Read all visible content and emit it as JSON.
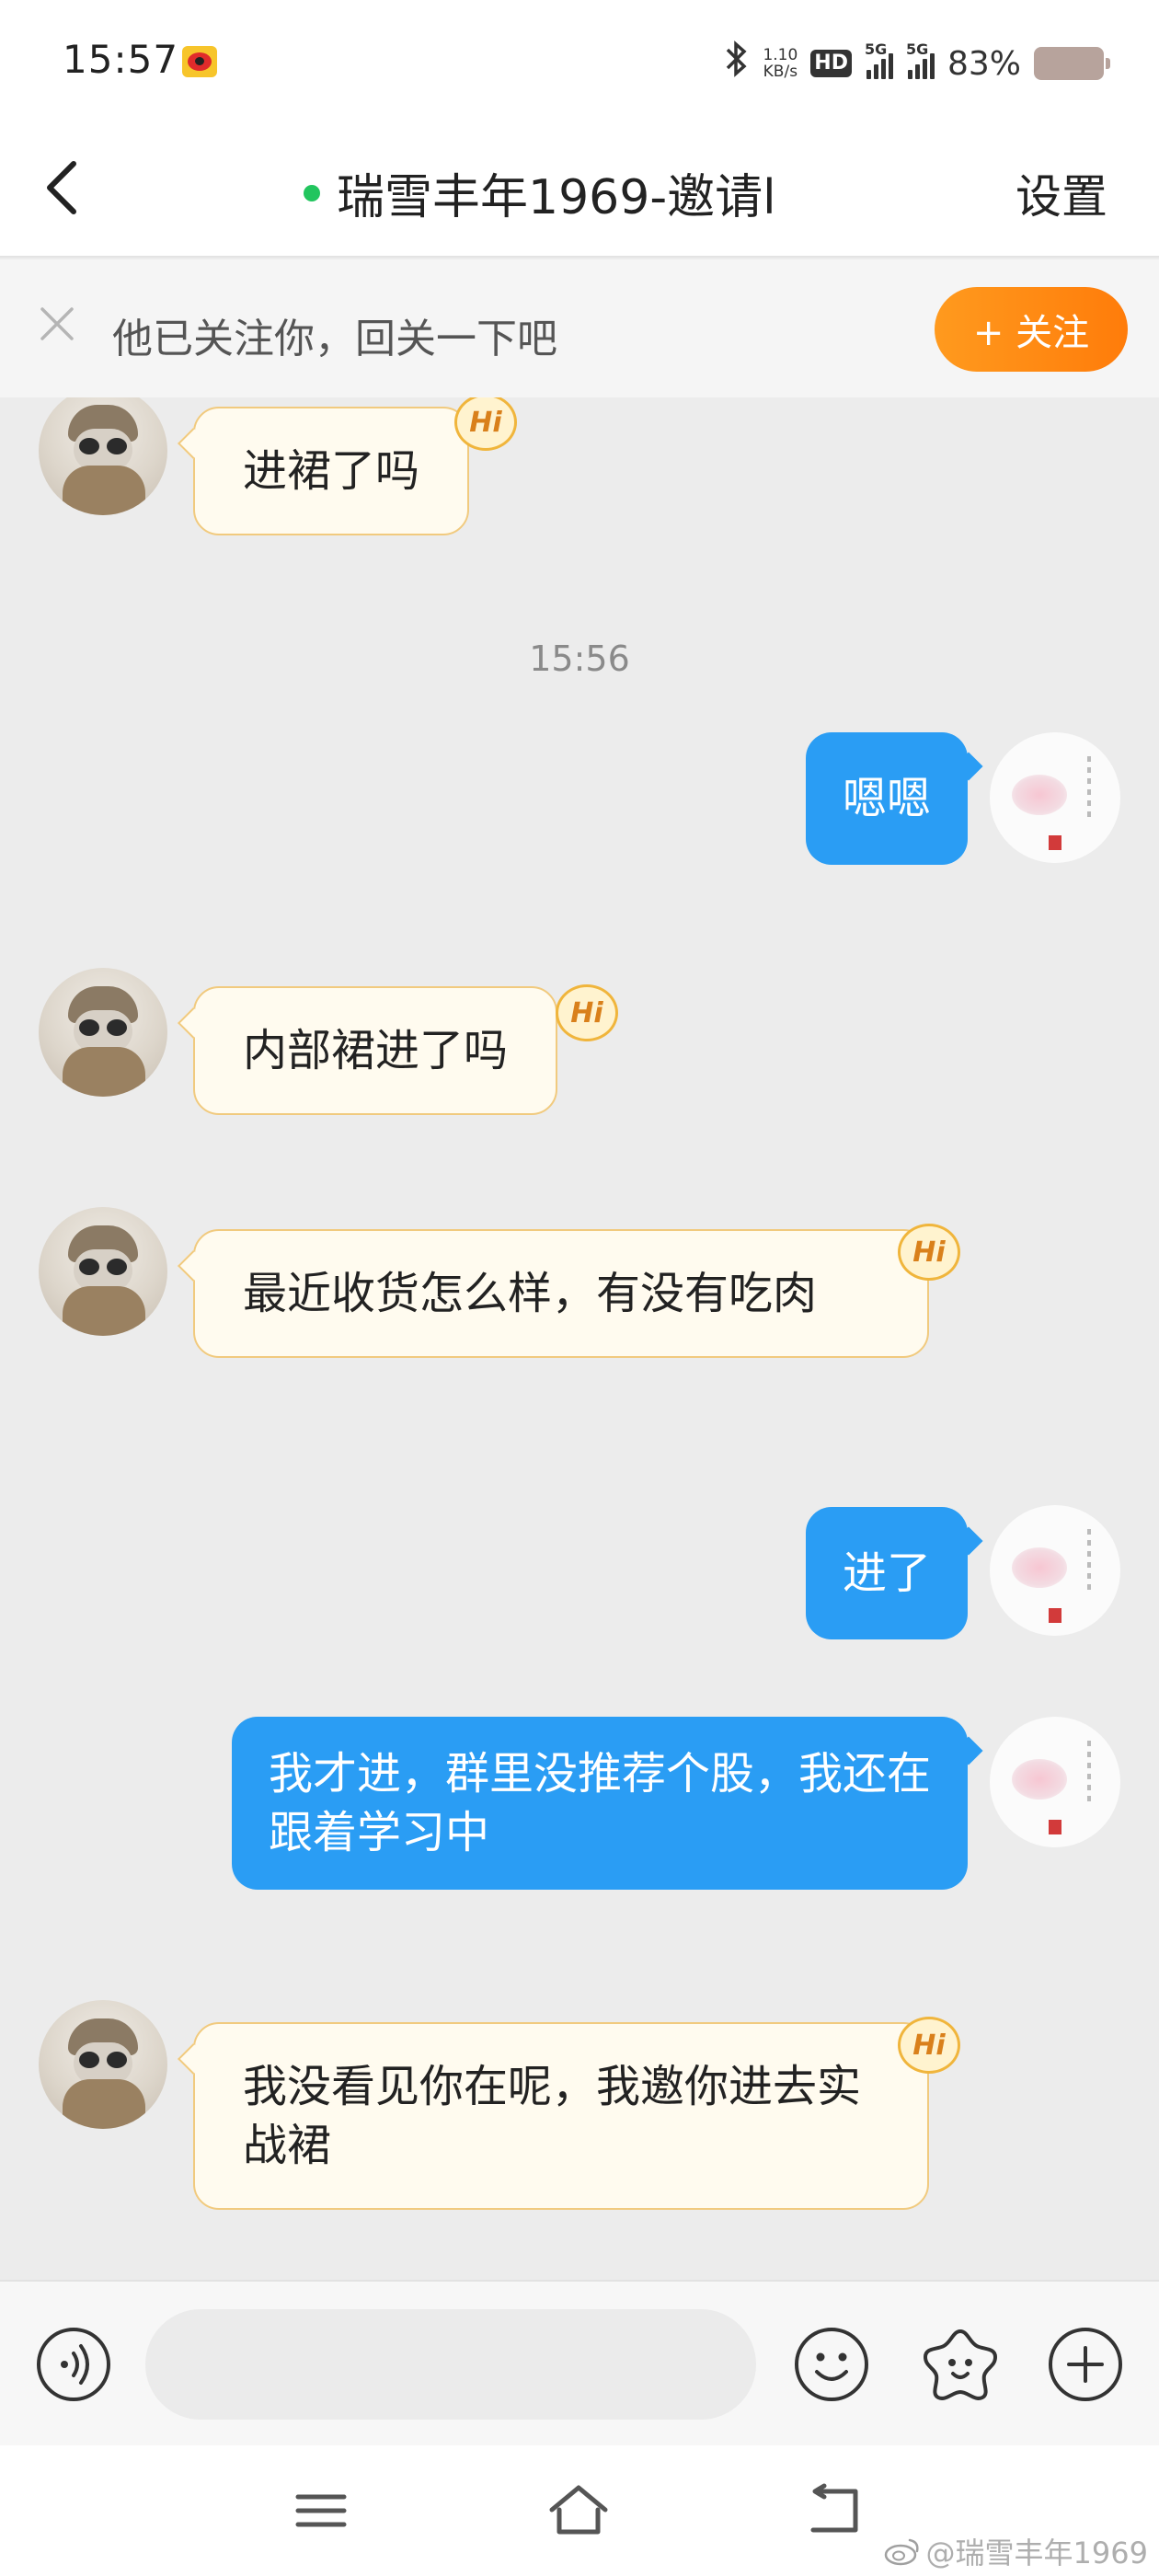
{
  "status_bar": {
    "time": "15:57",
    "net_speed_value": "1.10",
    "net_speed_unit": "KB/s",
    "hd_label": "HD",
    "sim1_label": "5G",
    "sim2_label": "5G",
    "battery_percent": "83%"
  },
  "header": {
    "title": "瑞雪丰年1969-邀请l",
    "settings_label": "设置",
    "online_color": "#22c55e"
  },
  "follow_banner": {
    "text": "他已关注你，回关一下吧",
    "button_label": "+ 关注"
  },
  "chat": {
    "time_separator": "15:56",
    "hi_label": "Hi",
    "messages": [
      {
        "side": "left",
        "text": "进裙了吗"
      },
      {
        "side": "right",
        "text": "嗯嗯"
      },
      {
        "side": "left",
        "text": "内部裙进了吗"
      },
      {
        "side": "left",
        "text": "最近收货怎么样，有没有吃肉"
      },
      {
        "side": "right",
        "text": "进了"
      },
      {
        "side": "right",
        "text": "我才进，群里没推荐个股，我还在跟着学习中"
      },
      {
        "side": "left",
        "text": "我没看见你在呢，我邀你进去实战裙"
      }
    ]
  },
  "input_bar": {
    "placeholder": "",
    "icons": [
      "voice-icon",
      "emoji-icon",
      "sticker-icon",
      "plus-icon"
    ]
  },
  "nav_bar": {
    "icons": [
      "menu-icon",
      "home-icon",
      "back-icon"
    ]
  },
  "watermark": "@瑞雪丰年1969",
  "colors": {
    "accent_blue": "#2a9df4",
    "follow_orange": "#ff8a12",
    "bubble_left_bg": "#fffbef",
    "bubble_left_border": "#f1ca7e"
  }
}
